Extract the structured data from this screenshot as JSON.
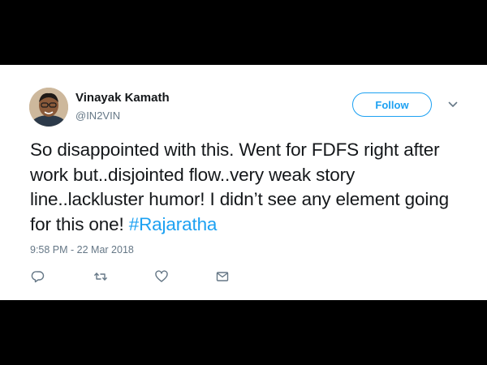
{
  "tweet": {
    "author": {
      "name": "Vinayak Kamath",
      "handle": "@IN2VIN"
    },
    "follow_label": "Follow",
    "text_main": "So disappointed with this. Went for FDFS right after work but..disjointed flow..very weak story line..lackluster humor! I didn’t see any element going for this one! ",
    "hashtag": "#Rajaratha",
    "timestamp": "9:58 PM - 22 Mar 2018",
    "actions": {
      "reply_icon": "reply-icon",
      "retweet_icon": "retweet-icon",
      "like_icon": "heart-icon",
      "message_icon": "envelope-icon"
    }
  },
  "colors": {
    "background": "#000000",
    "card": "#ffffff",
    "accent": "#1da1f2",
    "text_primary": "#14171a",
    "text_secondary": "#657786"
  }
}
